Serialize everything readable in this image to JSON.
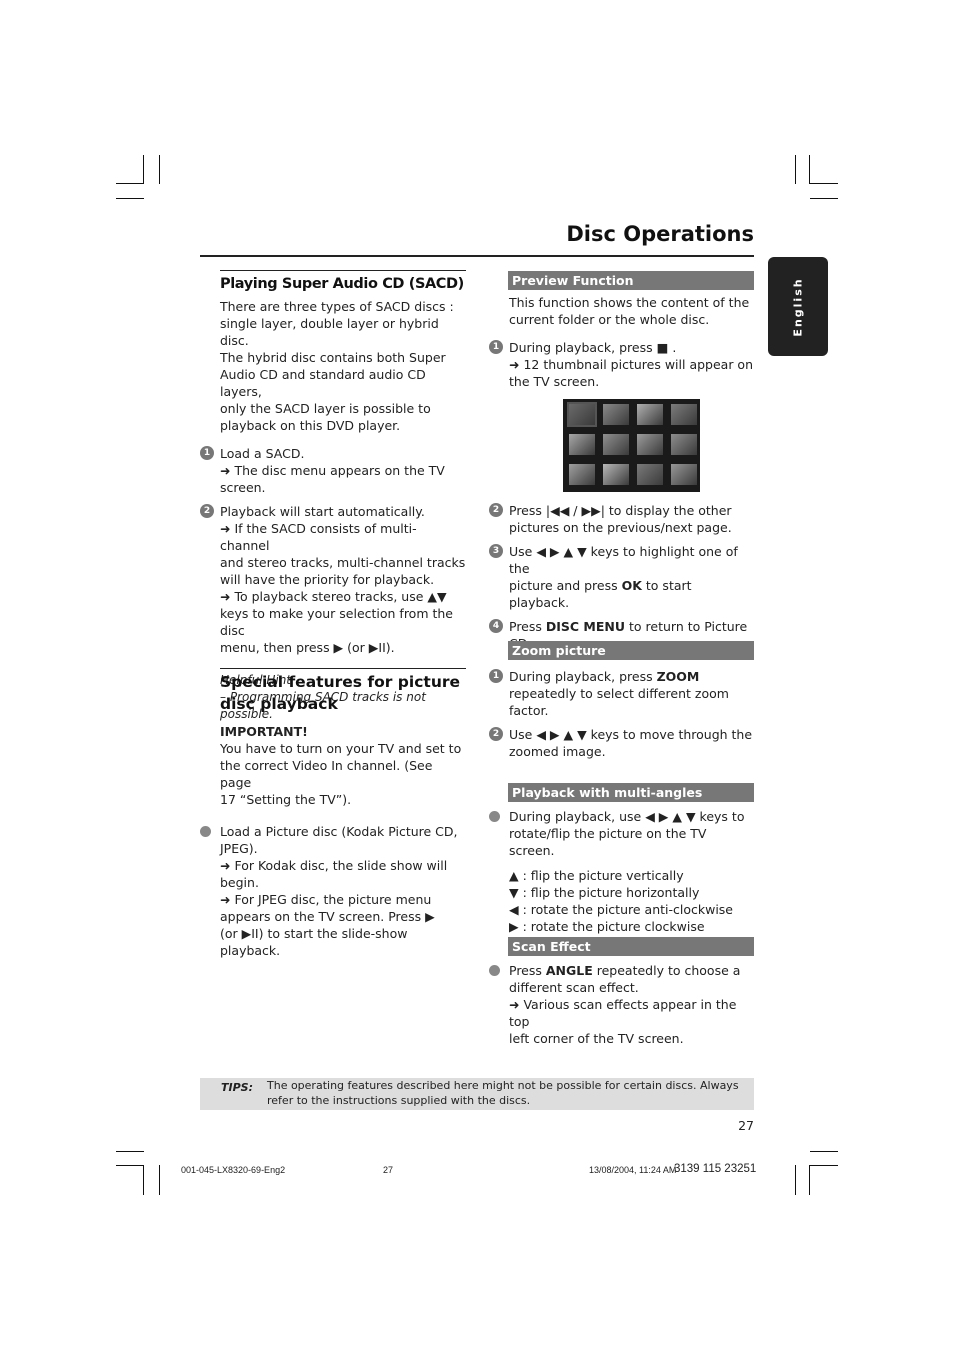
{
  "page": {
    "title": "Disc Operations",
    "language_tab": "English",
    "page_number": "27"
  },
  "left": {
    "sacd": {
      "heading": "Playing Super Audio CD (SACD)",
      "intro": [
        "There are three types of SACD discs :",
        "single layer, double layer or hybrid disc.",
        "The hybrid disc contains both Super",
        "Audio CD and standard audio CD layers,",
        "only the SACD layer is possible to",
        "playback on this DVD player."
      ],
      "steps": [
        {
          "num": "1",
          "lines": [
            "Load a SACD.",
            "➜ The disc menu appears on the TV",
            "screen."
          ]
        },
        {
          "num": "2",
          "lines": [
            "Playback will start automatically.",
            "➜ If the SACD consists of multi-channel",
            "and stereo tracks, multi-channel tracks",
            "will have the priority for playback.",
            "➜ To playback stereo tracks, use ▲▼",
            "keys to make your selection from the disc",
            "menu, then press ▶ (or ▶II)."
          ]
        }
      ],
      "hint_title": "Helpful Hint",
      "hint_text": "–  Programming SACD tracks is not possible."
    },
    "picture": {
      "heading_line1": "Special features for picture",
      "heading_line2": "disc playback",
      "important_label": "IMPORTANT!",
      "important_lines": [
        "You have to turn on your TV and set to",
        "the correct Video In channel.  (See page",
        "17 “Setting the TV”)."
      ],
      "bullet_lines": [
        "Load a Picture disc (Kodak Picture CD,",
        "JPEG).",
        "➜ For Kodak disc, the slide show will",
        "begin.",
        "➜ For JPEG disc, the picture menu",
        "appears on the TV screen.  Press ▶",
        "(or ▶II) to start the slide-show playback."
      ]
    }
  },
  "right": {
    "preview": {
      "heading": "Preview Function",
      "intro": [
        "This function shows the content of the",
        "current folder or the whole disc."
      ],
      "step1": [
        "During playback, press  ■ .",
        "➜ 12 thumbnail pictures will appear on",
        "the TV screen."
      ],
      "thumbnail_count": 12,
      "step2": [
        "Press |◀◀ / ▶▶| to display the other",
        "pictures on the previous/next page."
      ],
      "step3_pre": "Use ◀ ▶ ▲ ▼ keys to highlight one of the",
      "step3_line2_pre": "picture and press ",
      "step3_ok": "OK",
      "step3_line2_post": " to start playback.",
      "step4_pre": "Press ",
      "step4_key": "DISC MENU",
      "step4_post": " to return to Picture",
      "step4_line2": "CD menu."
    },
    "zoom": {
      "heading": "Zoom picture",
      "step1_pre": "During playback, press ",
      "step1_key": "ZOOM",
      "step1_lines": [
        "repeatedly to select different zoom",
        "factor."
      ],
      "step2": [
        "Use ◀ ▶ ▲ ▼ keys to move through the",
        "zoomed image."
      ]
    },
    "angles": {
      "heading": "Playback with multi-angles",
      "bullet": [
        "During playback, use ◀ ▶ ▲ ▼ keys to",
        "rotate/flip the picture on the TV screen."
      ],
      "keys": [
        "▲  : flip the picture vertically",
        "▼  : flip the picture horizontally",
        "◀  : rotate the picture anti-clockwise",
        "▶  : rotate the picture clockwise"
      ]
    },
    "scan": {
      "heading": "Scan Effect",
      "line1_pre": "Press ",
      "line1_key": "ANGLE",
      "line1_post": " repeatedly to choose a",
      "lines": [
        "different scan effect.",
        "➜ Various scan effects appear in the top",
        "left corner of the TV screen."
      ]
    }
  },
  "tips": {
    "label": "TIPS:",
    "text": "The operating features described here might not be possible for certain discs.  Always refer to the instructions supplied with the discs."
  },
  "footer": {
    "file": "001-045-LX8320-69-Eng2",
    "page": "27",
    "date": "13/08/2004, 11:24 AM",
    "code": "3139 115 23251"
  }
}
